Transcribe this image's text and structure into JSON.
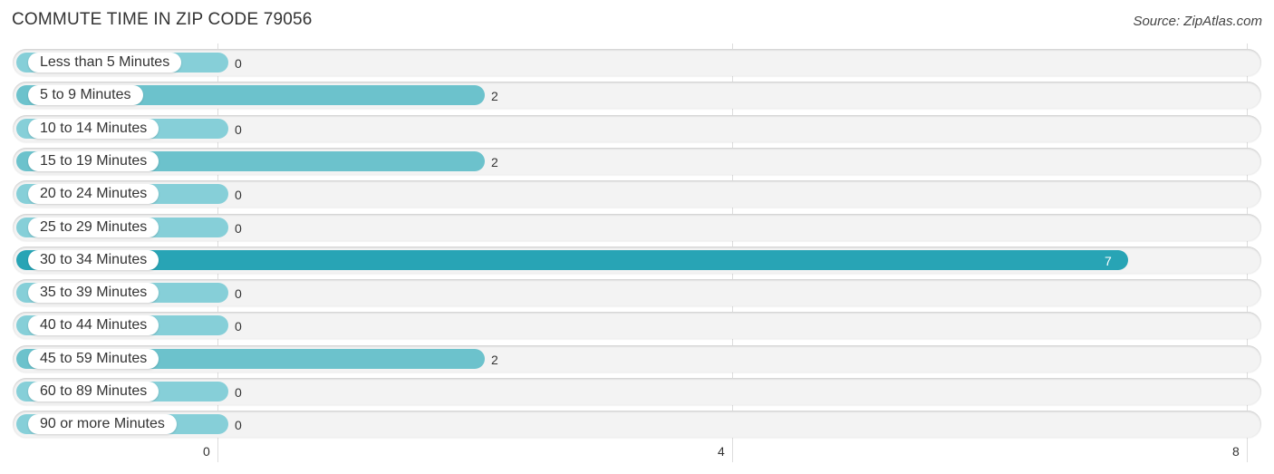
{
  "header": {
    "title": "COMMUTE TIME IN ZIP CODE 79056",
    "source": "Source: ZipAtlas.com"
  },
  "colors": {
    "bar_normal": "#6cc2cc",
    "bar_highlight": "#28a4b5",
    "bar_zero": "#86cfd8",
    "track": "#f3f3f3"
  },
  "chart_data": {
    "type": "bar",
    "orientation": "horizontal",
    "title": "COMMUTE TIME IN ZIP CODE 79056",
    "xlabel": "",
    "ylabel": "",
    "categories": [
      "Less than 5 Minutes",
      "5 to 9 Minutes",
      "10 to 14 Minutes",
      "15 to 19 Minutes",
      "20 to 24 Minutes",
      "25 to 29 Minutes",
      "30 to 34 Minutes",
      "35 to 39 Minutes",
      "40 to 44 Minutes",
      "45 to 59 Minutes",
      "60 to 89 Minutes",
      "90 or more Minutes"
    ],
    "values": [
      0,
      2,
      0,
      2,
      0,
      0,
      7,
      0,
      0,
      2,
      0,
      0
    ],
    "value_labels": [
      "0",
      "2",
      "0",
      "2",
      "0",
      "0",
      "7",
      "0",
      "0",
      "2",
      "0",
      "0"
    ],
    "highlight_index": 6,
    "xlim": [
      0,
      8
    ],
    "xticks": [
      0,
      4,
      8
    ],
    "xtick_labels": [
      "0",
      "4",
      "8"
    ],
    "grid": true,
    "legend": "none"
  }
}
